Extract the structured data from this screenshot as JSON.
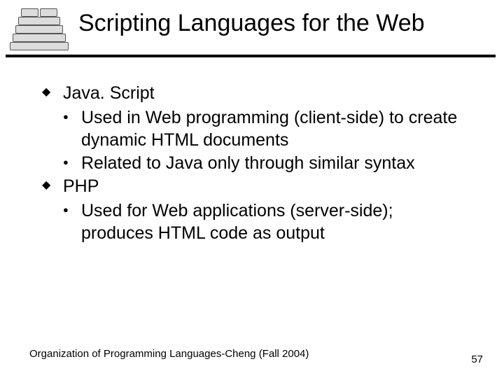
{
  "title": "Scripting Languages for the Web",
  "bullets": {
    "item0": {
      "label": "Java. Script",
      "sub0": "Used in Web programming (client-side) to create dynamic HTML documents",
      "sub1": "Related to Java only through similar syntax"
    },
    "item1": {
      "label": "PHP",
      "sub0": "Used for Web applications (server-side); produces HTML code as output"
    }
  },
  "footer": {
    "left": "Organization of Programming Languages-Cheng (Fall 2004)",
    "page": "57"
  }
}
